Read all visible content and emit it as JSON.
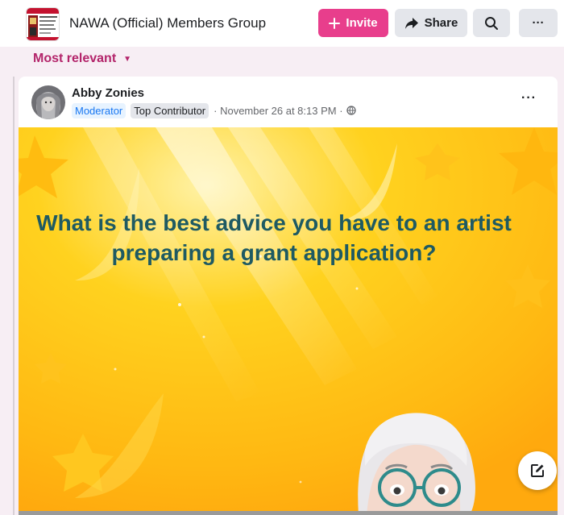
{
  "header": {
    "group_name": "NAWA (Official) Members Group",
    "invite_label": "Invite",
    "share_label": "Share",
    "more_label": "···"
  },
  "sort": {
    "label": "Most relevant"
  },
  "post": {
    "author": "Abby Zonies",
    "badges": [
      "Moderator",
      "Top Contributor"
    ],
    "timestamp": "· November 26 at 8:13 PM ·",
    "more_label": "···",
    "question": "What is the best advice you have to an artist preparing a grant application?"
  },
  "colors": {
    "accent": "#e83e8c",
    "sort_text": "#b3246a",
    "question_text": "#1e5a62",
    "media_bg": "#ffbf16"
  },
  "icons": {
    "invite": "plus-icon",
    "share": "share-arrow-icon",
    "search": "search-icon",
    "more": "more-dots-icon",
    "sort": "caret-down-icon",
    "privacy": "globe-icon",
    "compose": "compose-icon"
  }
}
